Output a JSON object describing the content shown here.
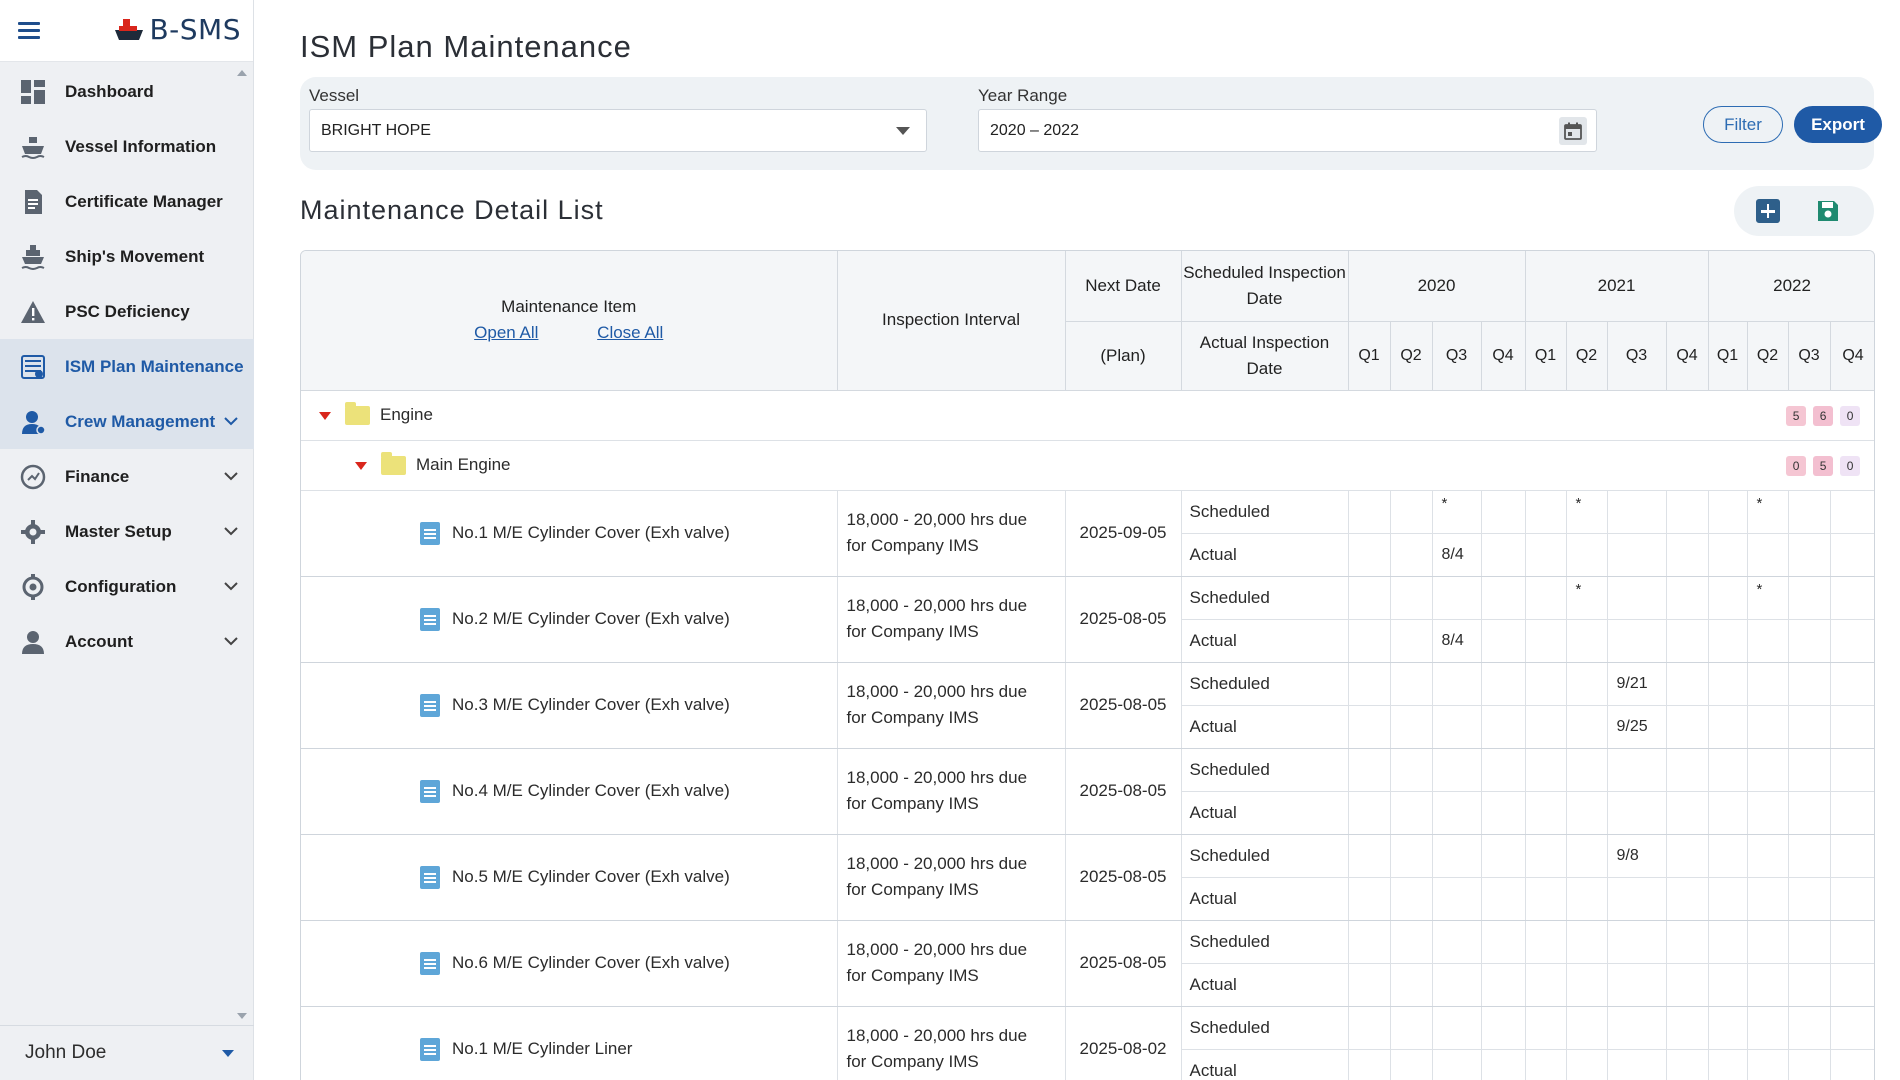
{
  "app": {
    "brand": "B-SMS"
  },
  "sidebar": {
    "items": [
      {
        "label": "Dashboard",
        "icon": "dashboard-icon"
      },
      {
        "label": "Vessel Information",
        "icon": "ship-icon"
      },
      {
        "label": "Certificate Manager",
        "icon": "certificate-icon"
      },
      {
        "label": "Ship's Movement",
        "icon": "ship-movement-icon"
      },
      {
        "label": "PSC Deficiency",
        "icon": "warning-icon"
      },
      {
        "label": "ISM Plan Maintenance",
        "icon": "maintenance-icon"
      },
      {
        "label": "Crew Management",
        "icon": "crew-icon"
      },
      {
        "label": "Finance",
        "icon": "finance-icon"
      },
      {
        "label": "Master Setup",
        "icon": "gear-icon"
      },
      {
        "label": "Configuration",
        "icon": "configuration-icon"
      },
      {
        "label": "Account",
        "icon": "user-icon"
      }
    ],
    "user": "John Doe"
  },
  "page": {
    "title": "ISM Plan Maintenance"
  },
  "filter": {
    "vessel_label": "Vessel",
    "vessel_value": "BRIGHT HOPE",
    "year_label": "Year Range",
    "year_value": "2020 – 2022",
    "filter_button": "Filter",
    "export_button": "Export"
  },
  "list": {
    "title": "Maintenance Detail List",
    "headers": {
      "item": "Maintenance Item",
      "open_all": "Open All",
      "close_all": "Close All",
      "interval": "Inspection Interval",
      "next_date": "Next Date",
      "plan": "(Plan)",
      "scheduled_date": "Scheduled Inspection Date",
      "actual_date": "Actual Inspection Date",
      "years": [
        "2020",
        "2021",
        "2022"
      ],
      "quarters": [
        "Q1",
        "Q2",
        "Q3",
        "Q4"
      ]
    },
    "groups": [
      {
        "name": "Engine",
        "badges": [
          "5",
          "6",
          "0"
        ]
      },
      {
        "name": "Main Engine",
        "badges": [
          "0",
          "5",
          "0"
        ]
      }
    ],
    "scheduled_label": "Scheduled",
    "actual_label": "Actual",
    "rows": [
      {
        "name": "No.1 M/E Cylinder Cover (Exh valve)",
        "interval1": "18,000 - 20,000 hrs due",
        "interval2": "for Company IMS",
        "next": "2025-09-05",
        "scheduled": [
          "",
          "",
          "*",
          "",
          "",
          "*",
          "",
          "",
          "",
          "*",
          "",
          ""
        ],
        "actual": [
          "",
          "",
          "8/4",
          "",
          "",
          "",
          "",
          "",
          "",
          "",
          "",
          ""
        ]
      },
      {
        "name": "No.2 M/E Cylinder Cover (Exh valve)",
        "interval1": "18,000 - 20,000 hrs due",
        "interval2": "for Company IMS",
        "next": "2025-08-05",
        "scheduled": [
          "",
          "",
          "",
          "",
          "",
          "*",
          "",
          "",
          "",
          "*",
          "",
          ""
        ],
        "actual": [
          "",
          "",
          "8/4",
          "",
          "",
          "",
          "",
          "",
          "",
          "",
          "",
          ""
        ]
      },
      {
        "name": "No.3 M/E Cylinder Cover (Exh valve)",
        "interval1": "18,000 - 20,000 hrs due",
        "interval2": "for Company IMS",
        "next": "2025-08-05",
        "scheduled": [
          "",
          "",
          "",
          "",
          "",
          "",
          "9/21",
          "",
          "",
          "",
          "",
          ""
        ],
        "actual": [
          "",
          "",
          "",
          "",
          "",
          "",
          "9/25",
          "",
          "",
          "",
          "",
          ""
        ]
      },
      {
        "name": "No.4 M/E Cylinder Cover (Exh valve)",
        "interval1": "18,000 - 20,000 hrs due",
        "interval2": "for Company IMS",
        "next": "2025-08-05",
        "scheduled": [
          "",
          "",
          "",
          "",
          "",
          "",
          "",
          "",
          "",
          "",
          "",
          ""
        ],
        "actual": [
          "",
          "",
          "",
          "",
          "",
          "",
          "",
          "",
          "",
          "",
          "",
          ""
        ]
      },
      {
        "name": "No.5 M/E Cylinder Cover (Exh valve)",
        "interval1": "18,000 - 20,000 hrs due",
        "interval2": "for Company IMS",
        "next": "2025-08-05",
        "scheduled": [
          "",
          "",
          "",
          "",
          "",
          "",
          "9/8",
          "",
          "",
          "",
          "",
          ""
        ],
        "actual": [
          "",
          "",
          "",
          "",
          "",
          "",
          "",
          "",
          "",
          "",
          "",
          ""
        ]
      },
      {
        "name": "No.6 M/E Cylinder Cover (Exh valve)",
        "interval1": "18,000 - 20,000 hrs due",
        "interval2": "for Company IMS",
        "next": "2025-08-05",
        "scheduled": [
          "",
          "",
          "",
          "",
          "",
          "",
          "",
          "",
          "",
          "",
          "",
          ""
        ],
        "actual": [
          "",
          "",
          "",
          "",
          "",
          "",
          "",
          "",
          "",
          "",
          "",
          ""
        ]
      },
      {
        "name": "No.1 M/E Cylinder Liner",
        "interval1": "18,000 - 20,000 hrs due",
        "interval2": "for Company IMS",
        "next": "2025-08-02",
        "scheduled": [
          "",
          "",
          "",
          "",
          "",
          "",
          "",
          "",
          "",
          "",
          "",
          ""
        ],
        "actual": [
          "",
          "",
          "",
          "",
          "",
          "",
          "",
          "",
          "",
          "",
          "",
          ""
        ]
      }
    ]
  }
}
